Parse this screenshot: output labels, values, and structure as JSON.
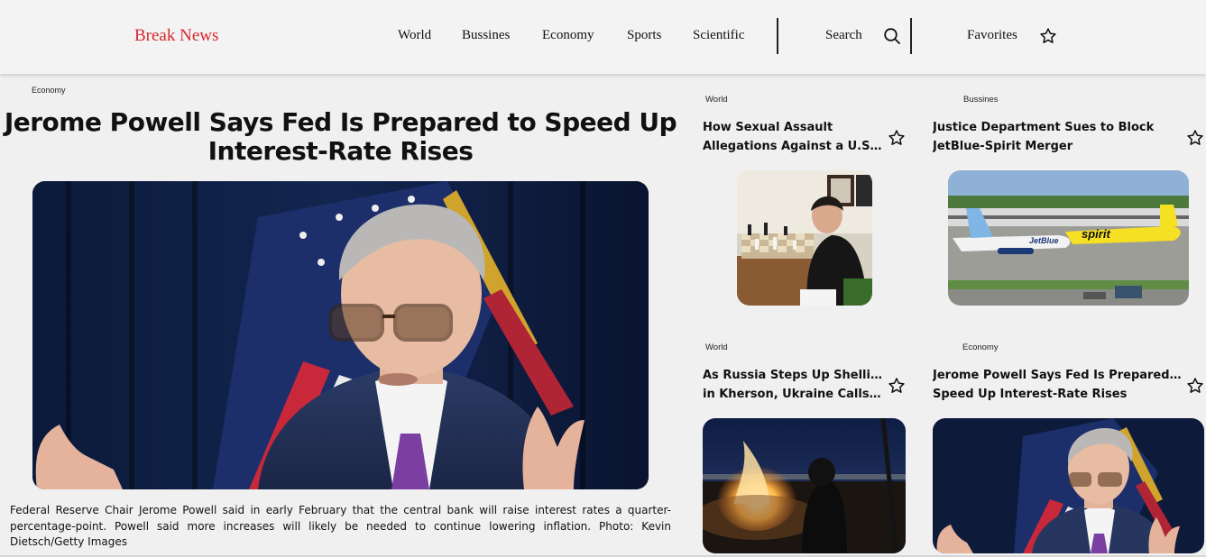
{
  "header": {
    "brand": "Break News",
    "nav": [
      "World",
      "Bussines",
      "Economy",
      "Sports",
      "Scientific"
    ],
    "search_label": "Search",
    "favorites_label": "Favorites"
  },
  "main_article": {
    "category": "Economy",
    "title_line1": "Jerome Powell Says Fed Is Prepared to Speed Up",
    "title_line2": "Interest-Rate Rises",
    "caption": "Federal Reserve Chair Jerome Powell said in early February that the central bank will raise interest rates a quarter-percentage-point. Powell said more increases will likely be needed to continue lowering inflation. Photo: Kevin Dietsch/Getty Images"
  },
  "cards": [
    {
      "category": "World",
      "title_line1": "How Sexual Assault",
      "title_line2": "Allegations Against a U.S...."
    },
    {
      "category": "Bussines",
      "title_line1": "Justice Department Sues to Block",
      "title_line2": "JetBlue-Spirit Merger"
    },
    {
      "category": "World",
      "title_line1": "As Russia Steps Up Shelling",
      "title_line2": "in Kherson, Ukraine Calls ..."
    },
    {
      "category": "Economy",
      "title_line1": "Jerome Powell Says Fed Is Prepared to",
      "title_line2": "Speed Up Interest-Rate Rises"
    }
  ],
  "images": {
    "airline_logo_left": "JetBlue",
    "airline_logo_right": "spirit"
  },
  "icons": {
    "search": "search-icon",
    "favorites": "star-icon",
    "card_favorite": "star-outline-icon"
  },
  "colors": {
    "brand": "#d9262b",
    "background": "#f0f0f0"
  }
}
